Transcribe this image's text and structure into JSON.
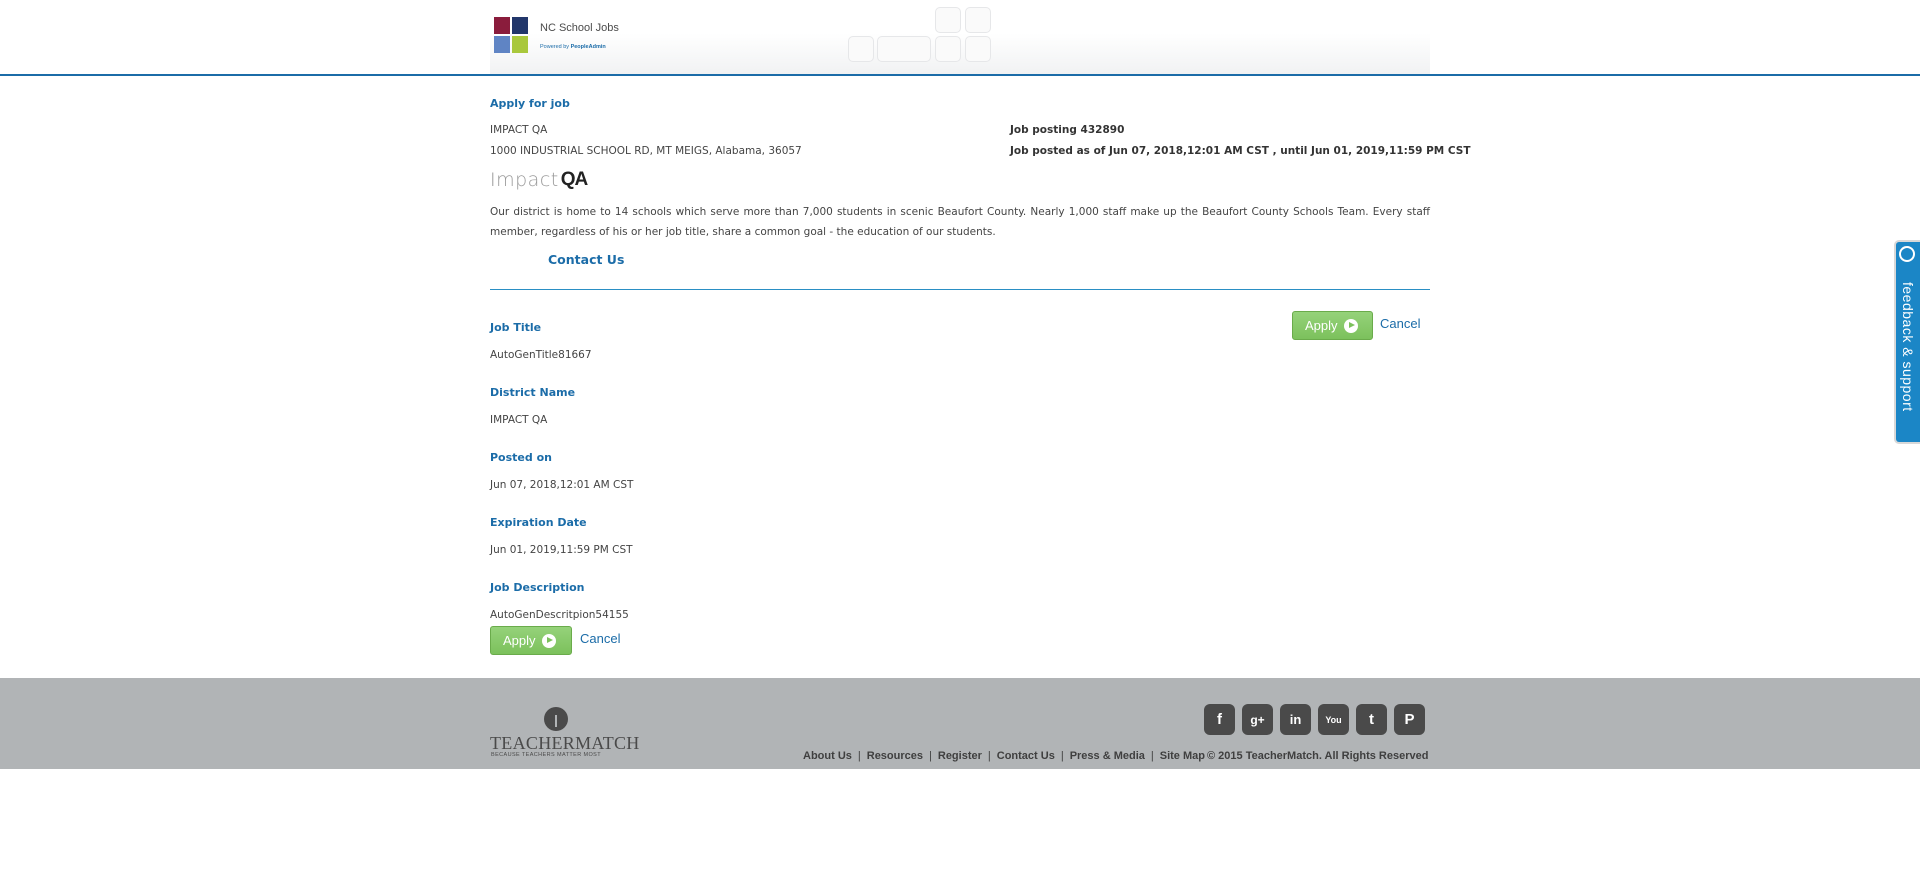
{
  "header": {
    "logo_title": "NC School Jobs",
    "logo_powered_prefix": "Powered by",
    "logo_powered_brand": "PeopleAdmin"
  },
  "job": {
    "apply_heading": "Apply for job",
    "district_name": "IMPACT QA",
    "address": "1000 INDUSTRIAL SCHOOL RD, MT MEIGS, Alabama, 36057",
    "posting_id": "Job posting 432890",
    "posted_range": "Job posted as of Jun 07, 2018,12:01 AM CST , until Jun 01, 2019,11:59 PM CST",
    "logo_impact": "Impact",
    "logo_qa": "QA",
    "description": "Our district is home to 14 schools which serve more than 7,000 students in scenic Beaufort County. Nearly 1,000 staff make up the Beaufort County Schools Team. Every staff member, regardless of his or her job title, share a common goal - the education of our students.",
    "contact_us": "Contact Us"
  },
  "actions": {
    "apply_label": "Apply",
    "cancel_label": "Cancel"
  },
  "details": {
    "job_title_label": "Job Title",
    "job_title_value": "AutoGenTitle81667",
    "district_label": "District Name",
    "district_value": "IMPACT QA",
    "posted_label": "Posted on",
    "posted_value": "Jun 07, 2018,12:01 AM CST",
    "expiration_label": "Expiration Date",
    "expiration_value": "Jun 01, 2019,11:59 PM CST",
    "description_label": "Job Description",
    "description_value": "AutoGenDescritpion54155"
  },
  "footer": {
    "brand": "TEACHERMATCH",
    "tagline": "BECAUSE TEACHERS MATTER MOST",
    "social": [
      {
        "icon": "facebook-icon",
        "glyph": "f"
      },
      {
        "icon": "google-plus-icon",
        "glyph": "g+"
      },
      {
        "icon": "linkedin-icon",
        "glyph": "in"
      },
      {
        "icon": "youtube-icon",
        "glyph": "You"
      },
      {
        "icon": "twitter-icon",
        "glyph": "t"
      },
      {
        "icon": "pinterest-icon",
        "glyph": "P"
      }
    ],
    "links": [
      "About Us",
      "Resources",
      "Register",
      "Contact Us",
      "Press & Media",
      "Site Map"
    ],
    "copyright": "© 2015 TeacherMatch. All Rights Reserved"
  },
  "feedback": {
    "label": "feedback & support"
  },
  "colors": {
    "brand_blue": "#1b6ca8",
    "apply_green": "#7cc15c",
    "footer_gray": "#b1b4b6",
    "feedback_blue": "#1b86c6"
  }
}
